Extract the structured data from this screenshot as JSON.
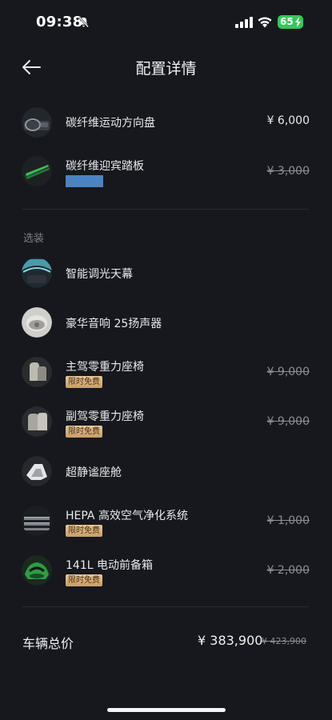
{
  "status_bar": {
    "time": "09:38",
    "battery": "65"
  },
  "header": {
    "title": "配置详情"
  },
  "standard_items": [
    {
      "name": "碳纤维运动方向盘",
      "price": "¥ 6,000"
    },
    {
      "name": "碳纤维迎宾踏板",
      "price": "¥ 3,000"
    }
  ],
  "optional_section": {
    "label": "选装",
    "items": [
      {
        "name": "智能调光天幕"
      },
      {
        "name": "豪华音响 25扬声器"
      },
      {
        "name": "主驾零重力座椅",
        "badge": "限时免费",
        "price": "¥ 9,000"
      },
      {
        "name": "副驾零重力座椅",
        "badge": "限时免费",
        "price": "¥ 9,000"
      },
      {
        "name": "超静谧座舱"
      },
      {
        "name": "HEPA 高效空气净化系统",
        "badge": "限时免费",
        "price": "¥ 1,000"
      },
      {
        "name": "141L 电动前备箱",
        "badge": "限时免费",
        "price": "¥ 2,000"
      }
    ]
  },
  "total": {
    "label": "车辆总价",
    "price": "¥ 383,900",
    "original_price": "¥ 423,900"
  },
  "colors": {
    "background": "#16181d",
    "badge_gold": "#d9b37f",
    "tag_blue": "#4b84c1",
    "battery_green": "#35c759"
  }
}
